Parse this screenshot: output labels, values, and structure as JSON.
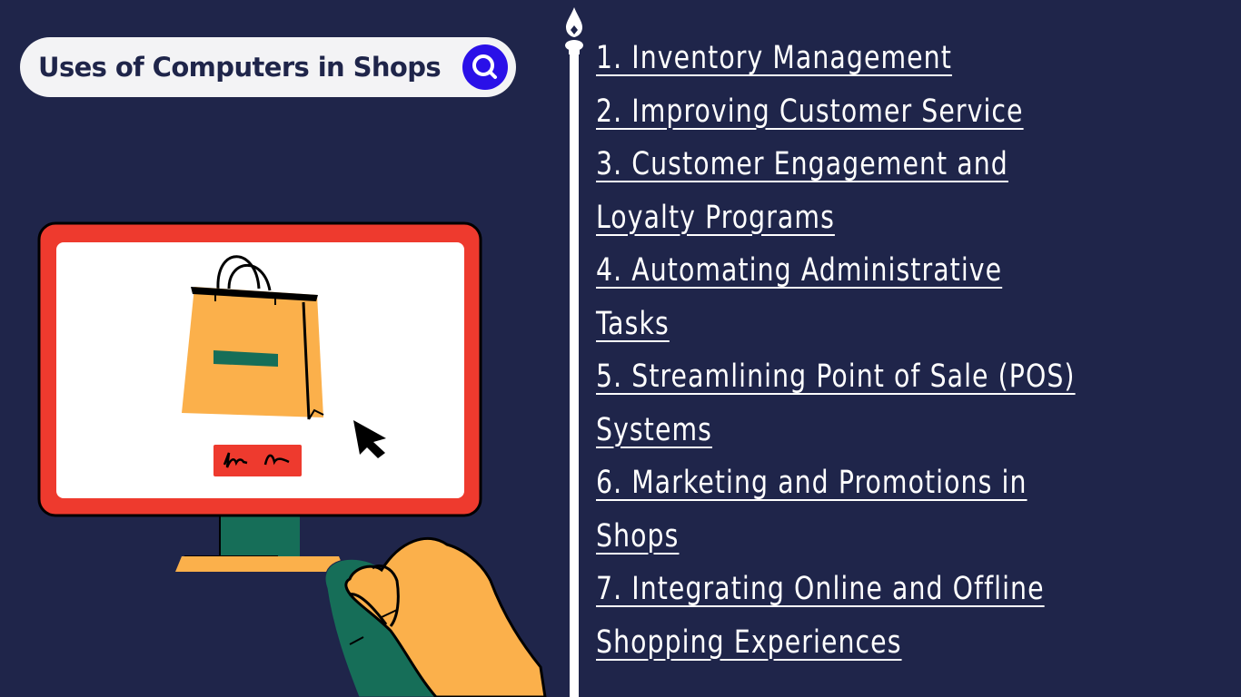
{
  "header": {
    "title": "Uses of Computers in Shops",
    "search_icon": "magnifier-icon"
  },
  "colors": {
    "background": "#1f254a",
    "pill": "#f3f3f5",
    "search_button": "#2a10e8",
    "monitor_frame": "#ee3a2e",
    "bag": "#fbb04b",
    "accent_green": "#166e58",
    "text": "#ffffff"
  },
  "divider_icon": "pen-nib-icon",
  "list": [
    {
      "lines": [
        "1. Inventory Management"
      ]
    },
    {
      "lines": [
        "2. Improving Customer Service"
      ]
    },
    {
      "lines": [
        "3. Customer Engagement and",
        "Loyalty Programs"
      ]
    },
    {
      "lines": [
        "4. Automating Administrative",
        "Tasks"
      ]
    },
    {
      "lines": [
        "5. Streamlining Point of Sale (POS)",
        "Systems"
      ]
    },
    {
      "lines": [
        "6. Marketing and Promotions in",
        "Shops"
      ]
    },
    {
      "lines": [
        "7. Integrating Online and Offline",
        "Shopping Experiences"
      ]
    }
  ],
  "illustration": {
    "monitor_icon": "monitor-icon",
    "bag_icon": "shopping-bag-icon",
    "cursor_icon": "mouse-pointer-icon",
    "button_icon": "buy-button-icon",
    "hand_icon": "hand-on-mouse-icon"
  }
}
